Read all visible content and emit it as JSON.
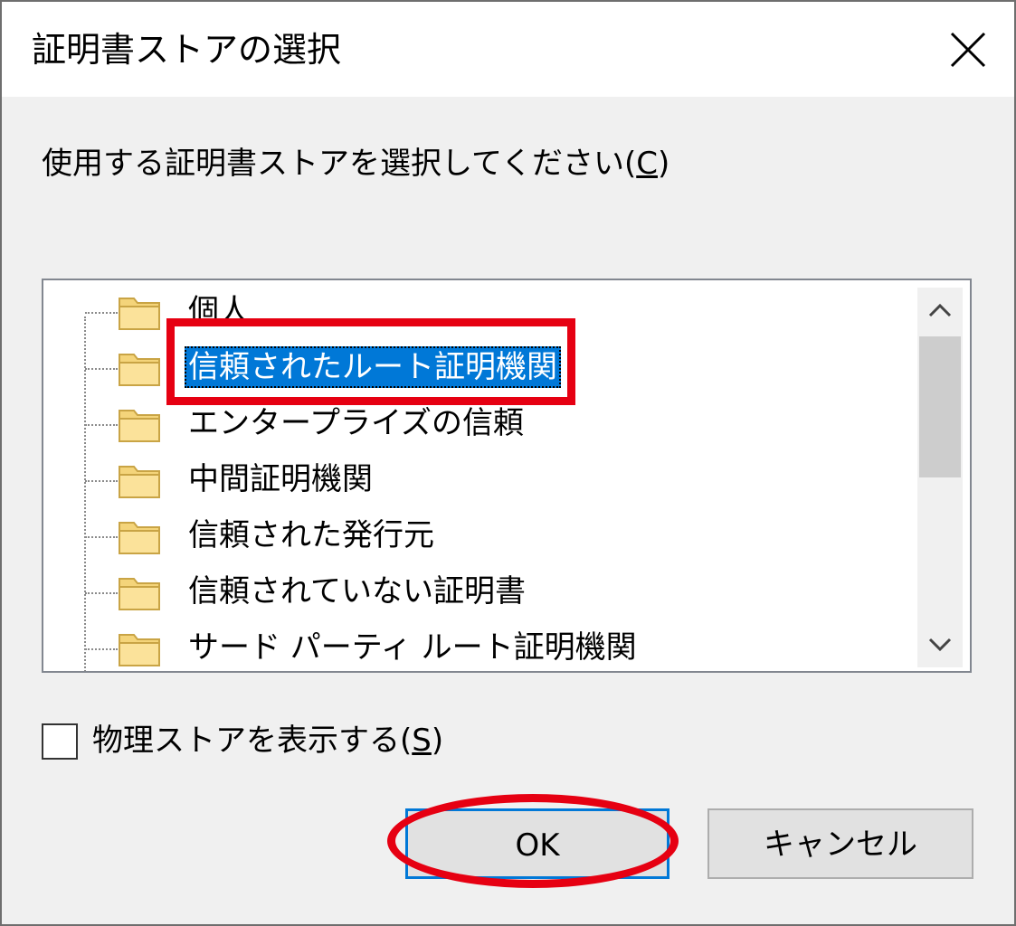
{
  "dialog": {
    "title": "証明書ストアの選択",
    "close_icon": "close-icon"
  },
  "prompt": {
    "text": "使用する証明書ストアを選択してください(",
    "accelerator": "C",
    "close": ")"
  },
  "store_tree": {
    "items": [
      {
        "label": "個人",
        "selected": false
      },
      {
        "label": "信頼されたルート証明機関",
        "selected": true
      },
      {
        "label": "エンタープライズの信頼",
        "selected": false
      },
      {
        "label": "中間証明機関",
        "selected": false
      },
      {
        "label": "信頼された発行元",
        "selected": false
      },
      {
        "label": "信頼されていない証明書",
        "selected": false
      },
      {
        "label": "サード パーティ ルート証明機関",
        "selected": false
      }
    ],
    "selection_color": "#0078d7"
  },
  "physical_store_checkbox": {
    "label": "物理ストアを表示する(",
    "accelerator": "S",
    "close": ")",
    "checked": false
  },
  "buttons": {
    "ok_label": "OK",
    "cancel_label": "キャンセル"
  },
  "annotation": {
    "highlight_color": "#e60012"
  }
}
